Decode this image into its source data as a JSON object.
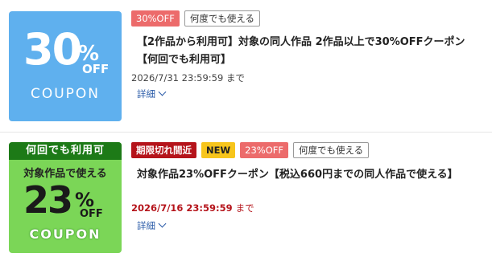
{
  "coupons": [
    {
      "image": {
        "big": "30",
        "pct": "%",
        "off": "OFF",
        "coupon": "COUPON"
      },
      "tags": [
        "30%OFF",
        "何度でも使える"
      ],
      "title": "【2作品から利用可】対象の同人作品 2作品以上で30%OFFクーポン【何回でも利用可】",
      "deadline": "2026/7/31 23:59:59",
      "deadline_suffix": "まで",
      "details_label": "詳細"
    },
    {
      "image": {
        "ribbon": "何回でも利用可",
        "sub": "対象作品で使える",
        "big": "23",
        "pct": "%",
        "off": "OFF",
        "coupon": "COUPON"
      },
      "tags": [
        "期限切れ間近",
        "NEW",
        "23%OFF",
        "何度でも使える"
      ],
      "title": "対象作品23%OFFクーポン【税込660円までの同人作品で使える】",
      "deadline": "2026/7/16 23:59:59",
      "deadline_suffix": "まで",
      "details_label": "詳細"
    }
  ],
  "colors": {
    "coupon1_bg": "#5fb0ee",
    "coupon2_bg": "#7bd657",
    "off_tag": "#ec6b6b",
    "expiring_tag": "#b5141b",
    "new_tag": "#f7c51c",
    "link": "#2a5ba8"
  }
}
